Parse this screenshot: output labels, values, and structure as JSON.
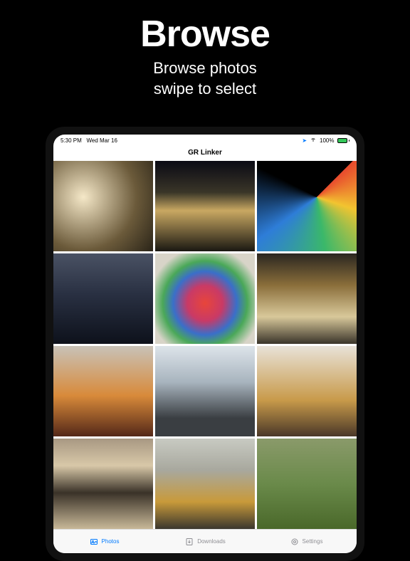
{
  "promo": {
    "title": "Browse",
    "line1": "Browse photos",
    "line2": "swipe to select"
  },
  "statusBar": {
    "time": "5:30 PM",
    "date": "Wed Mar 16",
    "battery": "100%"
  },
  "nav": {
    "title": "GR Linker"
  },
  "tabs": {
    "photos": "Photos",
    "downloads": "Downloads",
    "settings": "Settings"
  },
  "colors": {
    "accent": "#007aff",
    "inactive": "#8e8e93"
  }
}
